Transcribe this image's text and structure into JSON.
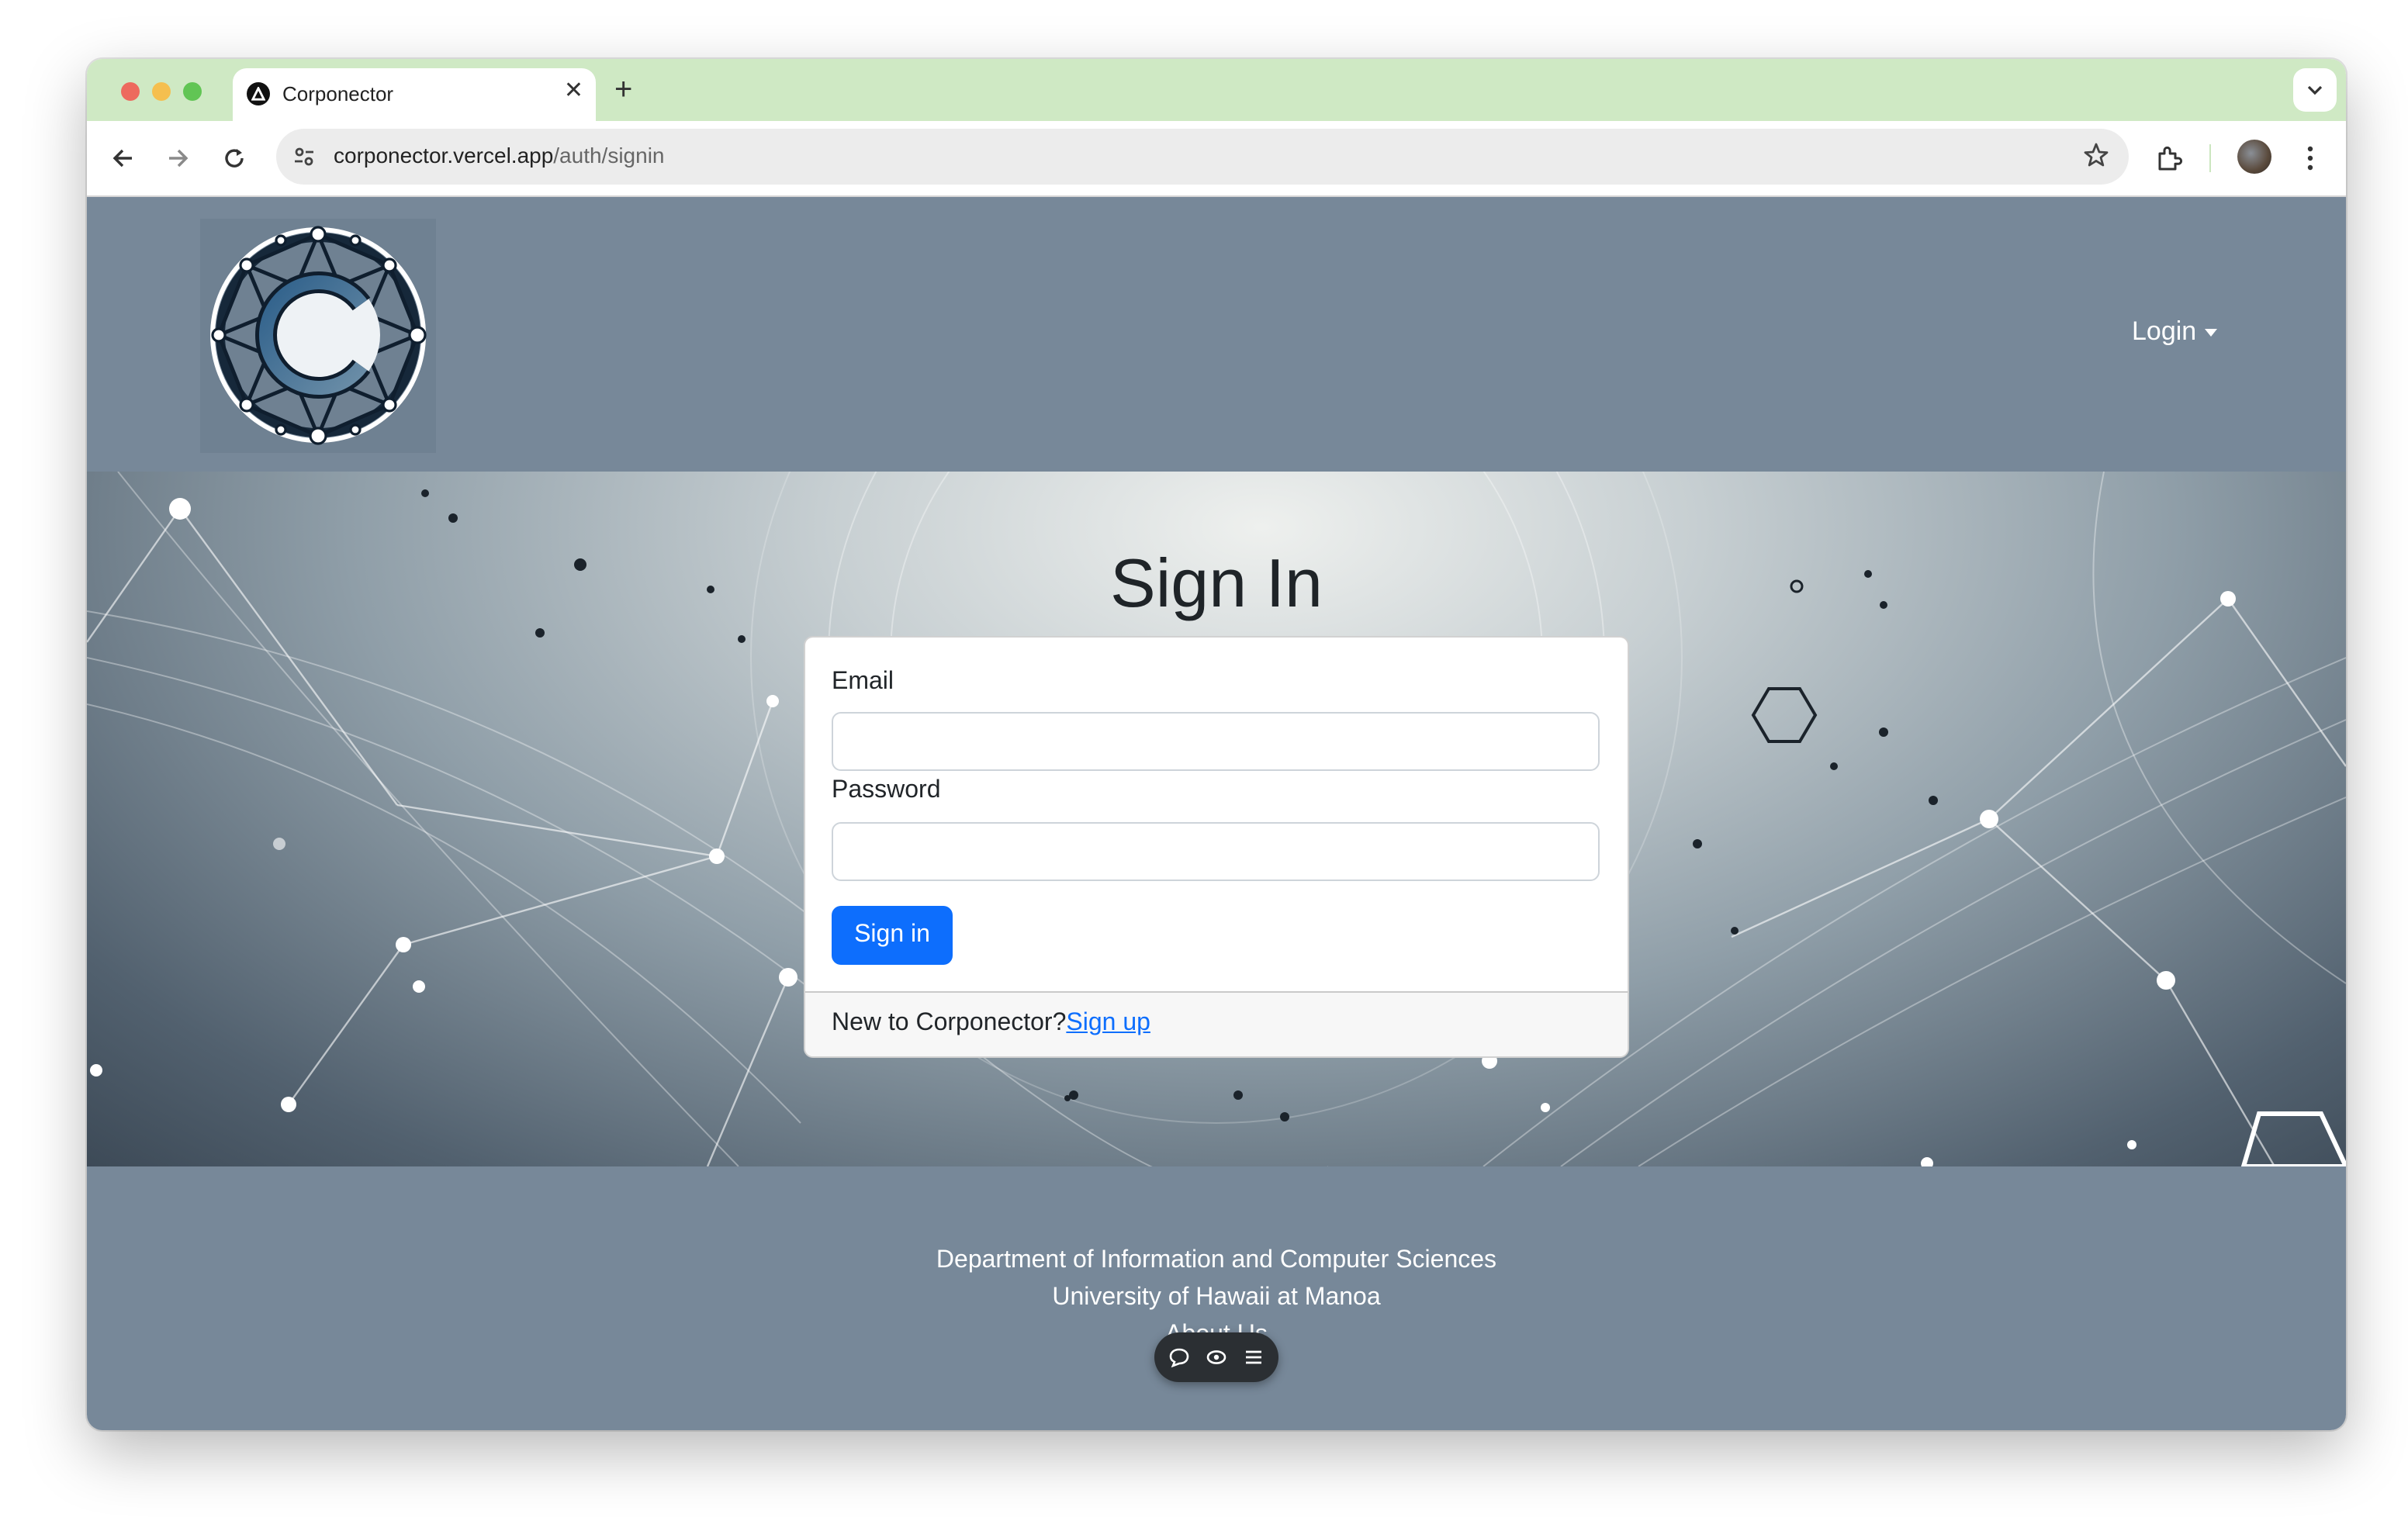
{
  "browser": {
    "tab_title": "Corponector",
    "url_host": "corponector.vercel.app",
    "url_path": "/auth/signin"
  },
  "navbar": {
    "login_label": "Login"
  },
  "signin": {
    "heading": "Sign In",
    "email_label": "Email",
    "email_value": "",
    "password_label": "Password",
    "password_value": "",
    "submit_label": "Sign in",
    "footer_text": "New to Corponector?",
    "signup_link": "Sign up"
  },
  "footer": {
    "line1": "Department of Information and Computer Sciences",
    "line2": "University of Hawaii at Manoa",
    "line3": "About Us"
  },
  "colors": {
    "navbar_bg": "#778899",
    "primary": "#0d6efd",
    "tabbar_bg": "#cfe9c4"
  }
}
